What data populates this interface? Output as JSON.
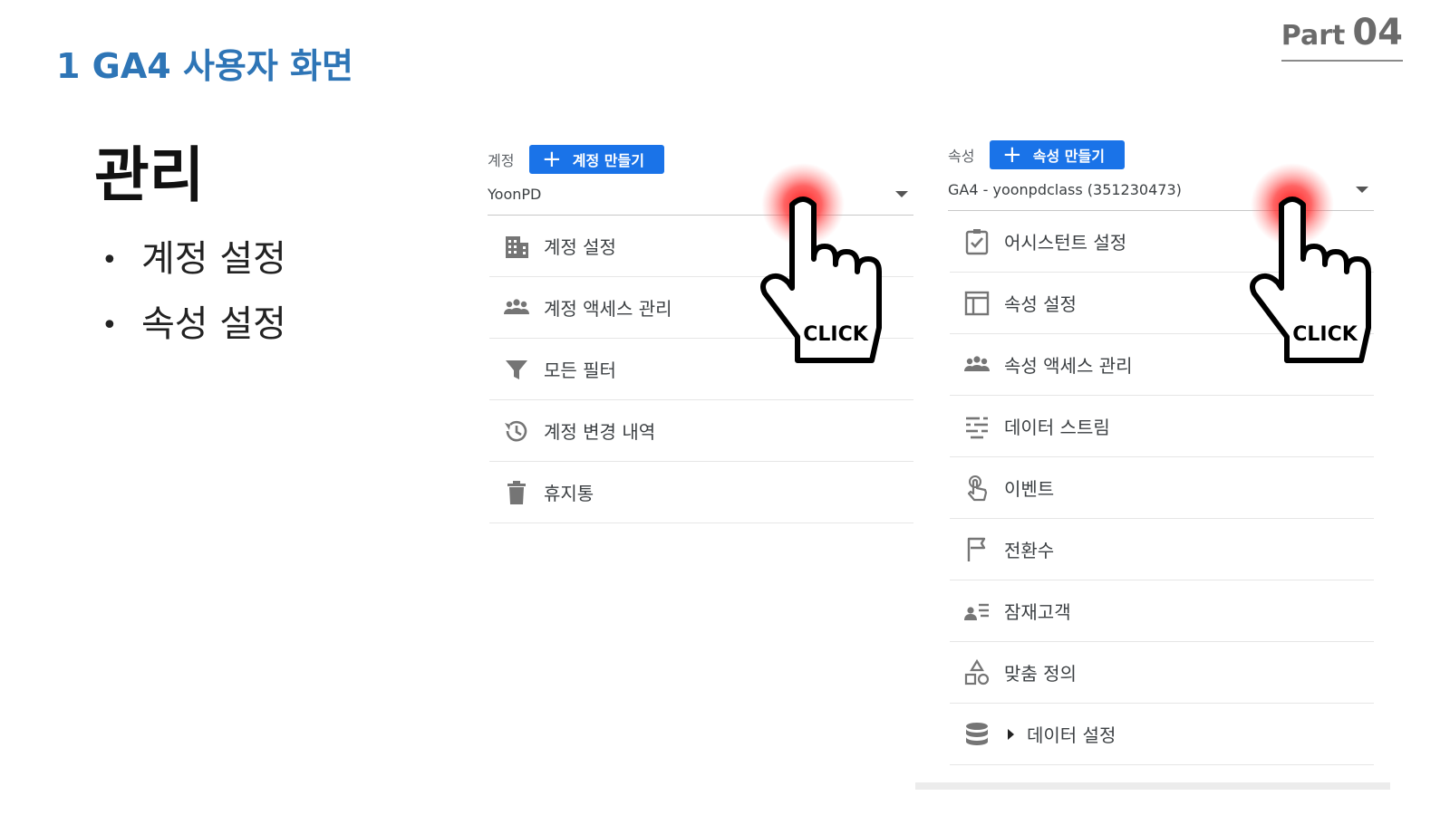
{
  "header": {
    "part_word": "Part",
    "part_number": "04",
    "section_title": "1 GA4 사용자 화면"
  },
  "main": {
    "title": "관리",
    "bullets": [
      "계정 설정",
      "속성 설정"
    ]
  },
  "account_panel": {
    "label": "계정",
    "create_button": "계정 만들기",
    "selected": "YoonPD",
    "items": [
      {
        "label": "계정 설정",
        "icon": "building-icon"
      },
      {
        "label": "계정 액세스 관리",
        "icon": "people-icon"
      },
      {
        "label": "모든 필터",
        "icon": "filter-icon"
      },
      {
        "label": "계정 변경 내역",
        "icon": "history-icon"
      },
      {
        "label": "휴지통",
        "icon": "trash-icon"
      }
    ]
  },
  "property_panel": {
    "label": "속성",
    "create_button": "속성 만들기",
    "selected": "GA4 - yoonpdclass (351230473)",
    "items": [
      {
        "label": "어시스턴트 설정",
        "icon": "checklist-icon"
      },
      {
        "label": "속성 설정",
        "icon": "layout-icon"
      },
      {
        "label": "속성 액세스 관리",
        "icon": "people-icon"
      },
      {
        "label": "데이터 스트림",
        "icon": "stream-icon"
      },
      {
        "label": "이벤트",
        "icon": "touch-icon"
      },
      {
        "label": "전환수",
        "icon": "flag-icon"
      },
      {
        "label": "잠재고객",
        "icon": "audience-icon"
      },
      {
        "label": "맞춤 정의",
        "icon": "shapes-icon"
      },
      {
        "label": "데이터 설정",
        "icon": "database-icon"
      }
    ]
  },
  "cursor_label": "CLICK",
  "colors": {
    "section_blue": "#2e75b6",
    "button_blue": "#1a73e8",
    "click_glow": "#ff2020"
  }
}
